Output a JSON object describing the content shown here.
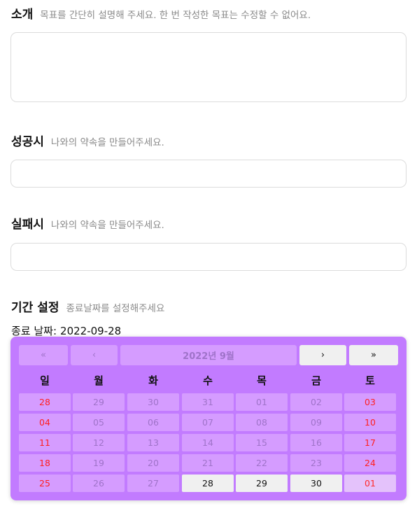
{
  "sections": {
    "intro": {
      "title": "소개",
      "hint": "목표를 간단히 설명해 주세요. 한 번 작성한 목표는 수정할 수 없어요."
    },
    "success": {
      "title": "성공시",
      "hint": "나와의 약속을 만들어주세요."
    },
    "failure": {
      "title": "실패시",
      "hint": "나와의 약속을 만들어주세요."
    },
    "period": {
      "title": "기간 설정",
      "hint": "종료날짜를 설정해주세요"
    }
  },
  "end_date": {
    "label": "종료 날짜:",
    "value": "2022-09-28"
  },
  "calendar": {
    "nav": {
      "prev_year": "«",
      "prev_month": "‹",
      "month_label": "2022년 9월",
      "next_month": "›",
      "next_year": "»"
    },
    "weekdays": [
      "일",
      "월",
      "화",
      "수",
      "목",
      "금",
      "토"
    ],
    "weeks": [
      [
        "28",
        "29",
        "30",
        "31",
        "01",
        "02",
        "03"
      ],
      [
        "04",
        "05",
        "06",
        "07",
        "08",
        "09",
        "10"
      ],
      [
        "11",
        "12",
        "13",
        "14",
        "15",
        "16",
        "17"
      ],
      [
        "18",
        "19",
        "20",
        "21",
        "22",
        "23",
        "24"
      ],
      [
        "25",
        "26",
        "27",
        "28",
        "29",
        "30",
        "01"
      ]
    ],
    "colors": {
      "accent": "#c27bff",
      "weekend": "#ff1f1f",
      "disabled_text": "#9f73c9"
    }
  }
}
